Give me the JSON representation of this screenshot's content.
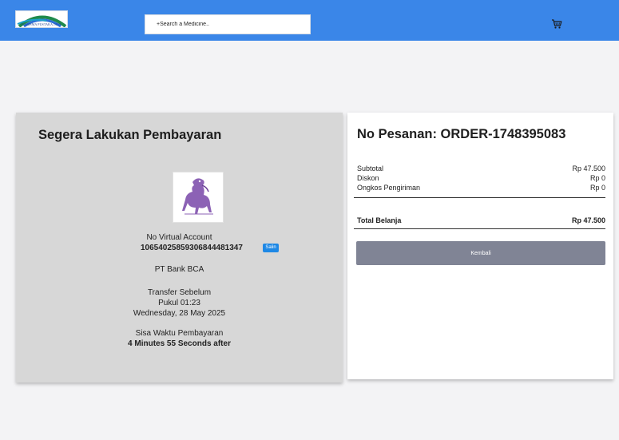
{
  "header": {
    "logo_text": "KARISMA PUSTAKA JAYA",
    "search": {
      "placeholder": "+Search a Medicine.."
    },
    "cart_icon": "shopping-cart-icon",
    "accent_color": "#3a86e8"
  },
  "payment": {
    "title": "Segera Lakukan Pembayaran",
    "bank_logo_icon": "bank-logo",
    "va_label": "No Virtual Account",
    "va_number": "1065402585930684448134​7",
    "copy_label": "Salin",
    "bank_name": "PT Bank BCA",
    "transfer_label": "Transfer Sebelum",
    "time": "Pukul 01:23",
    "date": "Wednesday, 28 May 2025",
    "remaining_label": "Sisa Waktu Pembayaran",
    "remaining_value": "4 Minutes 55 Seconds after"
  },
  "order": {
    "title": "No Pesanan: ORDER-1748395083",
    "rows": [
      {
        "label": "Subtotal",
        "value": "Rp 47.500"
      },
      {
        "label": "Diskon",
        "value": "Rp 0"
      },
      {
        "label": "Ongkos Pengiriman",
        "value": "Rp 0"
      }
    ],
    "total_label": "Total Belanja",
    "total_value": "Rp 47.500",
    "back_label": "Kembali"
  }
}
